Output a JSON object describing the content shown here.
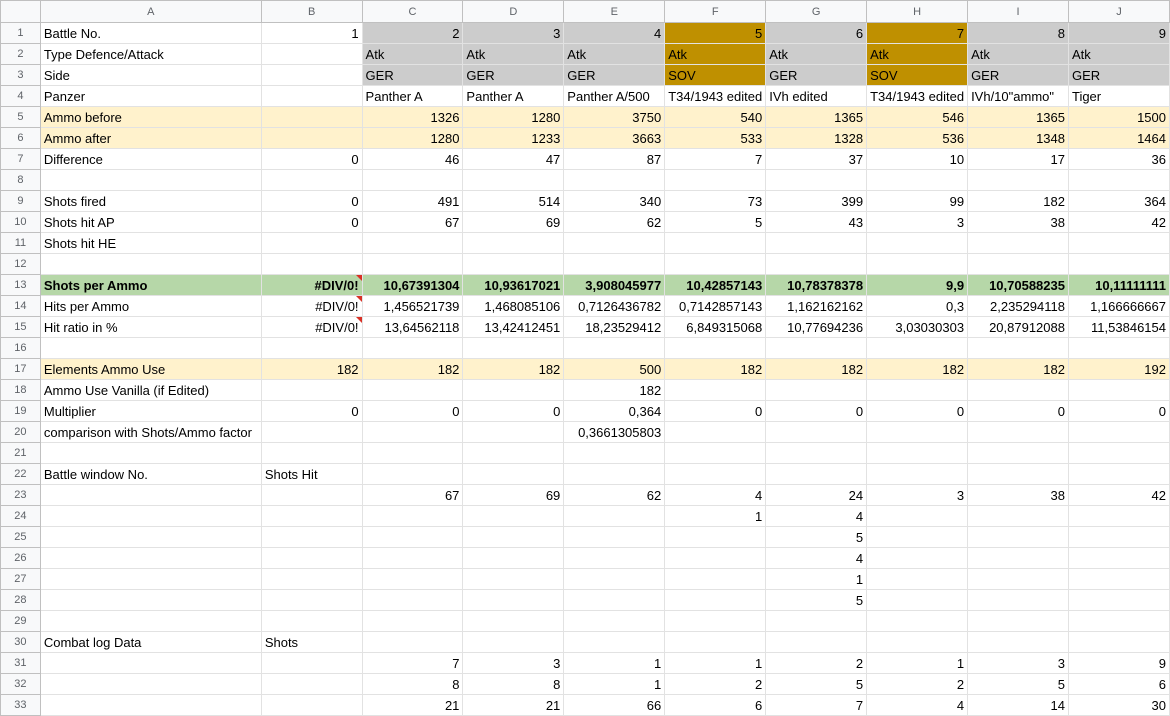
{
  "columns": [
    "A",
    "B",
    "C",
    "D",
    "E",
    "F",
    "G",
    "H",
    "I",
    "J"
  ],
  "colors": {
    "header_gray": "#cccccc",
    "highlight_gold": "#bf9000",
    "yellow": "#fff2cc",
    "green": "#b6d7a8"
  },
  "rows": [
    [
      "Battle No.",
      "1",
      "2",
      "3",
      "4",
      "5",
      "6",
      "7",
      "8",
      "9"
    ],
    [
      "Type Defence/Attack",
      "",
      "Atk",
      "Atk",
      "Atk",
      "Atk",
      "Atk",
      "Atk",
      "Atk",
      "Atk"
    ],
    [
      "Side",
      "",
      "GER",
      "GER",
      "GER",
      "SOV",
      "GER",
      "SOV",
      "GER",
      "GER"
    ],
    [
      "Panzer",
      "",
      "Panther A",
      "Panther A",
      "Panther A/500",
      "T34/1943 edited",
      "IVh edited",
      "T34/1943 edited",
      "IVh/10\"ammo\"",
      "Tiger"
    ],
    [
      "Ammo before",
      "",
      "1326",
      "1280",
      "3750",
      "540",
      "1365",
      "546",
      "1365",
      "1500"
    ],
    [
      "Ammo after",
      "",
      "1280",
      "1233",
      "3663",
      "533",
      "1328",
      "536",
      "1348",
      "1464"
    ],
    [
      "Difference",
      "0",
      "46",
      "47",
      "87",
      "7",
      "37",
      "10",
      "17",
      "36"
    ],
    [
      "",
      "",
      "",
      "",
      "",
      "",
      "",
      "",
      "",
      ""
    ],
    [
      "Shots fired",
      "0",
      "491",
      "514",
      "340",
      "73",
      "399",
      "99",
      "182",
      "364"
    ],
    [
      "Shots hit AP",
      "0",
      "67",
      "69",
      "62",
      "5",
      "43",
      "3",
      "38",
      "42"
    ],
    [
      "Shots hit HE",
      "",
      "",
      "",
      "",
      "",
      "",
      "",
      "",
      ""
    ],
    [
      "",
      "",
      "",
      "",
      "",
      "",
      "",
      "",
      "",
      ""
    ],
    [
      "Shots per Ammo",
      "#DIV/0!",
      "10,67391304",
      "10,93617021",
      "3,908045977",
      "10,42857143",
      "10,78378378",
      "9,9",
      "10,70588235",
      "10,11111111"
    ],
    [
      "Hits per Ammo",
      "#DIV/0!",
      "1,456521739",
      "1,468085106",
      "0,7126436782",
      "0,7142857143",
      "1,162162162",
      "0,3",
      "2,235294118",
      "1,166666667"
    ],
    [
      "Hit ratio in %",
      "#DIV/0!",
      "13,64562118",
      "13,42412451",
      "18,23529412",
      "6,849315068",
      "10,77694236",
      "3,03030303",
      "20,87912088",
      "11,53846154"
    ],
    [
      "",
      "",
      "",
      "",
      "",
      "",
      "",
      "",
      "",
      ""
    ],
    [
      "Elements Ammo Use",
      "182",
      "182",
      "182",
      "500",
      "182",
      "182",
      "182",
      "182",
      "192"
    ],
    [
      "Ammo Use Vanilla (if Edited)",
      "",
      "",
      "",
      "182",
      "",
      "",
      "",
      "",
      ""
    ],
    [
      "Multiplier",
      "0",
      "0",
      "0",
      "0,364",
      "0",
      "0",
      "0",
      "0",
      "0"
    ],
    [
      "comparison with Shots/Ammo factor",
      "",
      "",
      "",
      "0,3661305803",
      "",
      "",
      "",
      "",
      ""
    ],
    [
      "",
      "",
      "",
      "",
      "",
      "",
      "",
      "",
      "",
      ""
    ],
    [
      "Battle window No.",
      "Shots Hit",
      "",
      "",
      "",
      "",
      "",
      "",
      "",
      ""
    ],
    [
      "",
      "",
      "67",
      "69",
      "62",
      "4",
      "24",
      "3",
      "38",
      "42"
    ],
    [
      "",
      "",
      "",
      "",
      "",
      "1",
      "4",
      "",
      "",
      ""
    ],
    [
      "",
      "",
      "",
      "",
      "",
      "",
      "5",
      "",
      "",
      ""
    ],
    [
      "",
      "",
      "",
      "",
      "",
      "",
      "4",
      "",
      "",
      ""
    ],
    [
      "",
      "",
      "",
      "",
      "",
      "",
      "1",
      "",
      "",
      ""
    ],
    [
      "",
      "",
      "",
      "",
      "",
      "",
      "5",
      "",
      "",
      ""
    ],
    [
      "",
      "",
      "",
      "",
      "",
      "",
      "",
      "",
      "",
      ""
    ],
    [
      "Combat log Data",
      "Shots",
      "",
      "",
      "",
      "",
      "",
      "",
      "",
      ""
    ],
    [
      "",
      "",
      "7",
      "3",
      "1",
      "1",
      "2",
      "1",
      "3",
      "9"
    ],
    [
      "",
      "",
      "8",
      "8",
      "1",
      "2",
      "5",
      "2",
      "5",
      "6"
    ],
    [
      "",
      "",
      "21",
      "21",
      "66",
      "6",
      "7",
      "4",
      "14",
      "30"
    ]
  ]
}
